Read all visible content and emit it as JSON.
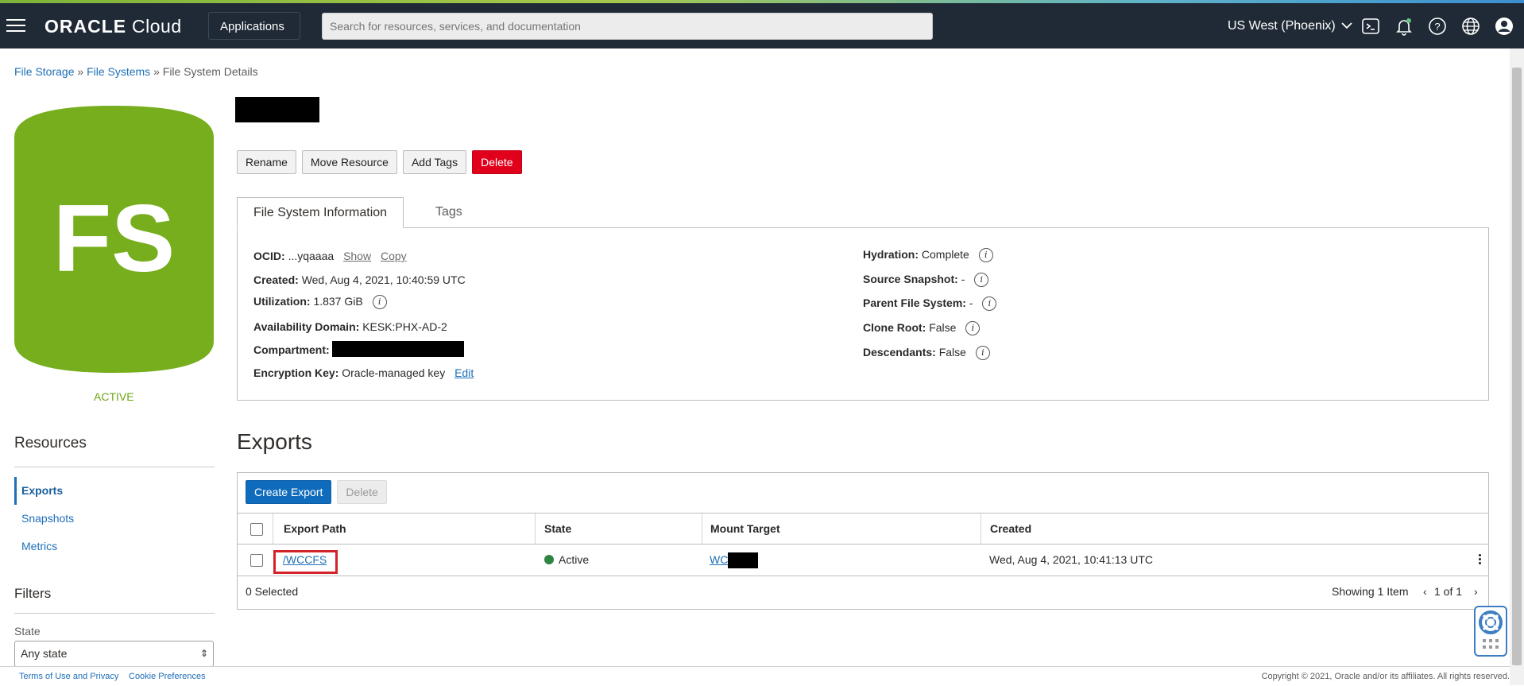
{
  "header": {
    "logo_main": "ORACLE",
    "logo_sub": "Cloud",
    "applications_label": "Applications",
    "search_placeholder": "Search for resources, services, and documentation",
    "region": "US West (Phoenix)",
    "icons": [
      "hamburger-menu-icon",
      "chevron-right-icon",
      "chevron-down-icon",
      "cloud-shell-icon",
      "bell-icon",
      "help-icon",
      "globe-icon",
      "user-profile-icon"
    ]
  },
  "breadcrumb": {
    "item1": "File Storage",
    "sep": "»",
    "item2": "File Systems",
    "current": "File System Details"
  },
  "badge": {
    "letters": "FS",
    "status": "ACTIVE",
    "color": "#76ae1d"
  },
  "actions": {
    "rename": "Rename",
    "move": "Move Resource",
    "tags": "Add Tags",
    "delete": "Delete"
  },
  "tabs": {
    "info": "File System Information",
    "tags": "Tags"
  },
  "info_left": {
    "ocid_label": "OCID:",
    "ocid_value": "...yqaaaa",
    "show": "Show",
    "copy": "Copy",
    "created_label": "Created:",
    "created_value": "Wed, Aug 4, 2021, 10:40:59 UTC",
    "util_label": "Utilization:",
    "util_value": "1.837 GiB",
    "ad_label": "Availability Domain:",
    "ad_value": "KESK:PHX-AD-2",
    "compartment_label": "Compartment:",
    "enc_label": "Encryption Key:",
    "enc_value": "Oracle-managed key",
    "edit": "Edit"
  },
  "info_right": {
    "hydration_label": "Hydration:",
    "hydration_value": "Complete",
    "snapshot_label": "Source Snapshot:",
    "snapshot_value": "-",
    "parent_label": "Parent File System:",
    "parent_value": "-",
    "clone_label": "Clone Root:",
    "clone_value": "False",
    "desc_label": "Descendants:",
    "desc_value": "False"
  },
  "resources": {
    "title": "Resources",
    "items": [
      {
        "label": "Exports"
      },
      {
        "label": "Snapshots"
      },
      {
        "label": "Metrics"
      }
    ]
  },
  "filters": {
    "title": "Filters",
    "state_label": "State",
    "state_value": "Any state"
  },
  "exports": {
    "title": "Exports",
    "create": "Create Export",
    "delete": "Delete",
    "columns": {
      "path": "Export Path",
      "state": "State",
      "mount": "Mount Target",
      "created": "Created"
    },
    "rows": [
      {
        "path": "/WCCFS",
        "state": "Active",
        "mount": "WC",
        "created": "Wed, Aug 4, 2021, 10:41:13 UTC"
      }
    ],
    "selected": "0 Selected",
    "showing": "Showing 1 Item",
    "page": "1 of 1"
  },
  "footer": {
    "terms": "Terms of Use and Privacy",
    "cookies": "Cookie Preferences",
    "copyright": "Copyright © 2021, Oracle and/or its affiliates. All rights reserved."
  }
}
